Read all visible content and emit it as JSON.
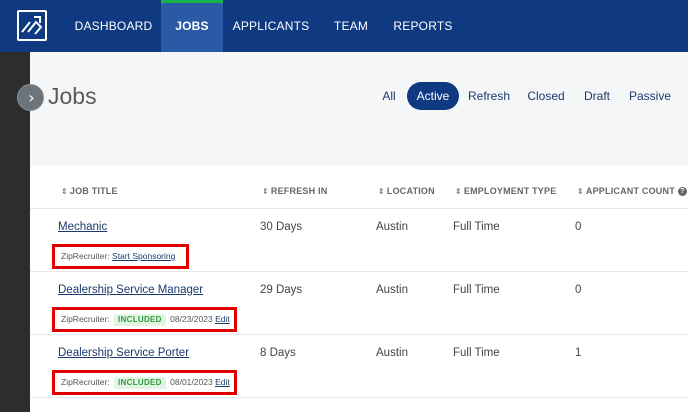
{
  "nav": {
    "items": [
      {
        "label": "DASHBOARD",
        "active": false
      },
      {
        "label": "JOBS",
        "active": true
      },
      {
        "label": "APPLICANTS",
        "active": false
      },
      {
        "label": "TEAM",
        "active": false
      },
      {
        "label": "REPORTS",
        "active": false
      }
    ],
    "logo_icon": "brand-logo-icon",
    "colors": {
      "bar": "#0f3a82",
      "active_tab": "#2a5aa6",
      "active_indicator": "#19b34c"
    }
  },
  "sidebar": {
    "expand_icon": "chevron-right-icon",
    "expand_glyph": "›"
  },
  "page": {
    "title": "Jobs"
  },
  "filters": [
    "All",
    "Active",
    "Refresh",
    "Closed",
    "Draft",
    "Passive"
  ],
  "active_filter": "Active",
  "table": {
    "sort_glyph": "⇕",
    "help_glyph": "?",
    "columns": [
      "JOB TITLE",
      "REFRESH IN",
      "LOCATION",
      "EMPLOYMENT TYPE",
      "APPLICANT COUNT"
    ],
    "rows": [
      {
        "title": "Mechanic",
        "refresh_in": "30 Days",
        "location": "Austin",
        "employment_type": "Full Time",
        "applicant_count": "0",
        "zip_label": "ZipRecruiter:",
        "zip_link": "Start Sponsoring"
      },
      {
        "title": "Dealership Service Manager",
        "refresh_in": "29 Days",
        "location": "Austin",
        "employment_type": "Full Time",
        "applicant_count": "0",
        "zip_label": "ZipRecruiter:",
        "zip_badge": "INCLUDED",
        "zip_date": "08/23/2023",
        "zip_edit": "Edit"
      },
      {
        "title": "Dealership Service Porter",
        "refresh_in": "8 Days",
        "location": "Austin",
        "employment_type": "Full Time",
        "applicant_count": "1",
        "zip_label": "ZipRecruiter:",
        "zip_badge": "INCLUDED",
        "zip_date": "08/01/2023",
        "zip_edit": "Edit"
      }
    ]
  }
}
